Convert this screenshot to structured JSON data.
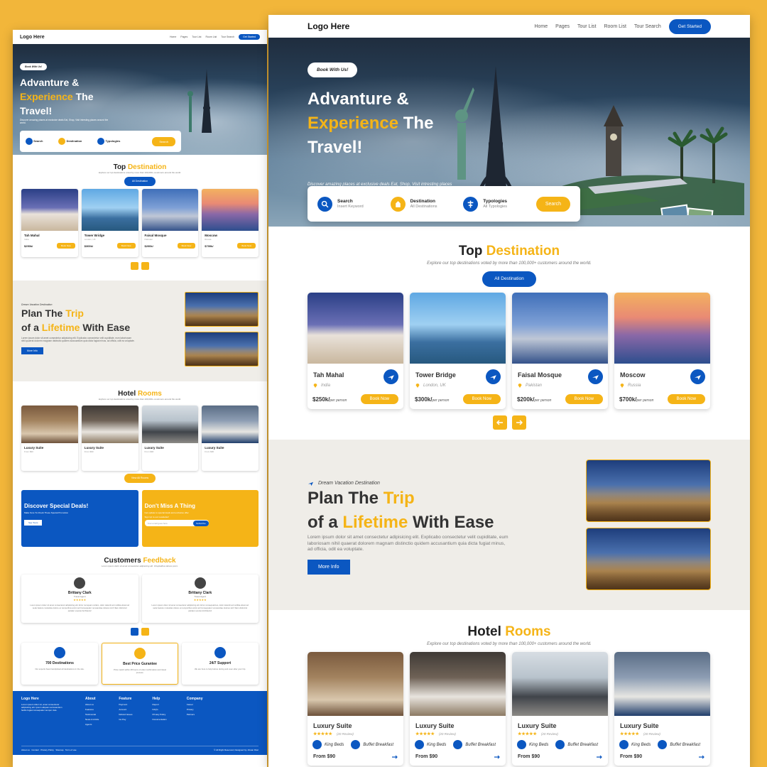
{
  "brand": {
    "logo": "Logo Here",
    "accent": "#F5B417",
    "primary": "#0B57C1",
    "frame_bg": "#F2B63A"
  },
  "nav": {
    "items": [
      "Home",
      "Pages",
      "Tour List",
      "Room List",
      "Tour Search"
    ],
    "cta": "Get Started"
  },
  "hero": {
    "badge": "Book With Us!",
    "title_a": "Advanture &",
    "title_b_accent": "Experience",
    "title_b_rest": " The",
    "title_c": "Travel!",
    "subtitle": "Discover amazing places at exclusive deals Eat, Shop, Visit intresting places around the world."
  },
  "search": {
    "fields": [
      {
        "label": "Search",
        "value": "Insert Keyword",
        "icon": "search-icon"
      },
      {
        "label": "Destination",
        "value": "All Destinations",
        "icon": "destination-icon"
      },
      {
        "label": "Typologies",
        "value": "All Typologies",
        "icon": "typology-icon"
      }
    ],
    "button": "Search"
  },
  "destinations": {
    "title_a": "Top ",
    "title_b": "Destination",
    "subtitle": "Explore our top destinations voted by more than 100,000+ customers around the world.",
    "button": "All Destination",
    "cards": [
      {
        "name": "Tah Mahal",
        "location": "India",
        "price": "$250k/",
        "unit": "per person",
        "cta": "Book Now"
      },
      {
        "name": "Tower Bridge",
        "location": "London, UK",
        "price": "$300k/",
        "unit": "per person",
        "cta": "Book Now"
      },
      {
        "name": "Faisal Mosque",
        "location": "Pakistan",
        "price": "$200k/",
        "unit": "per person",
        "cta": "Book Now"
      },
      {
        "name": "Moscow",
        "location": "Russia",
        "price": "$700k/",
        "unit": "per person",
        "cta": "Book Now"
      }
    ]
  },
  "plan": {
    "kicker": "Dream Vacation Destination",
    "title_a": "Plan The ",
    "title_b": "Trip",
    "title_c": "of a ",
    "title_d": "Lifetime",
    "title_e": " With Ease",
    "description": "Lorem ipsum dolor sit amet consectetur adipisicing elit. Explicabo consectetur velit cupiditate, eum laboriosam nihil quaerat dolorem magnam distinctio quidem accusantium quia dicta fugiat minus, ad officia, odit ea voluptate.",
    "button": "More Info"
  },
  "hotel": {
    "title_a": "Hotel ",
    "title_b": "Rooms",
    "subtitle": "Explore our top destinations voted by more than 100,000+ customers around the world.",
    "rooms": [
      {
        "name": "Luxury Suite",
        "stars": "★★★★★",
        "reviews": "(20 Review)",
        "bed": "King Beds",
        "food": "Buffet Breakfast",
        "price": "From $90"
      },
      {
        "name": "Luxury Suite",
        "stars": "★★★★★",
        "reviews": "(20 Review)",
        "bed": "King Beds",
        "food": "Buffet Breakfast",
        "price": "From $90"
      },
      {
        "name": "Luxury Suite",
        "stars": "★★★★★",
        "reviews": "(20 Review)",
        "bed": "King Beds",
        "food": "Buffet Breakfast",
        "price": "From $90"
      },
      {
        "name": "Luxury Suite",
        "stars": "★★★★★",
        "reviews": "(20 Review)",
        "bed": "King Beds",
        "food": "Buffet Breakfast",
        "price": "From $90"
      }
    ],
    "button": "View All Rooms"
  },
  "promos": {
    "deals_title": "Discover Special Deals!",
    "deals_sub": "Make Sure To Check These Special Promotion",
    "deals_btn": "See Tours",
    "miss_title": "Don't Miss A Thing",
    "miss_sub": "Get update to special deals and exclusive offer.",
    "miss_note": "Sign Up to our newsletter!",
    "email_placeholder": "Your email goes here",
    "subscribe": "Subscribe"
  },
  "feedback": {
    "title_a": "Customers ",
    "title_b": "Feedback",
    "subtitle": "Lorem ipsum dolor sit amet consectetur adipisicing elit. Voluptatibus labore porro.",
    "items": [
      {
        "name": "Brittany Clark",
        "role": "Travel Agent",
        "stars": "★★★★★",
        "text": "Lorem ipsum dolor sit amet consectetur adipisicing elit. Error numquam cullam, dolor deleniti ad mollitia eliusmod sede feature molestias dolore ex temporibus animi ad Consequatur recusandae dolores sint! Iliam distinctol pariatur eveniet Architecto!"
      },
      {
        "name": "Brittany Clark",
        "role": "Travel Agent",
        "stars": "★★★★★",
        "text": "Lorem ipsum dolor sit amet consectetur adipisicing elit. Error consequatinos, dolor deleniti ad mollitia eliusmod sede feature molestias dolore ex temporibus animi ad Consequatur recusandae dolores sint! Iliam distinctol pariatur eveniet Architecto!"
      }
    ]
  },
  "features": [
    {
      "title": "700 Destinations",
      "text": "Our experts have handpicked all destinations in the site."
    },
    {
      "title": "Best Price Gurantee",
      "text": "Price match within 48 hours of order confirmation and travel process."
    },
    {
      "title": "24/7 Support",
      "text": "We are here to help before during and even after your trip."
    }
  ],
  "footer": {
    "about_text": "Lorem ipsum dolor sit, amet consectetur adipisicing elit. Ipsum aliquam accusantium facilis fugiat consequatur tempor duis.",
    "cols": [
      {
        "title": "About",
        "items": [
          "About us",
          "Features",
          "Testimonial",
          "News & Article",
          "Agents"
        ]
      },
      {
        "title": "Feature",
        "items": [
          "Payment",
          "Account",
          "Refund Issues",
          "Go Pay"
        ]
      },
      {
        "title": "Help",
        "items": [
          "Report",
          "FAQ's",
          "Privacy Policy",
          "Documentation"
        ]
      },
      {
        "title": "Company",
        "items": [
          "Career",
          "Privacy",
          "Partners"
        ]
      }
    ],
    "bottom_links": [
      "About us",
      "Contact",
      "Privacy Policy",
      "Sitemap",
      "Term of use"
    ],
    "copyright": "© All Right Reserved, Designed by: Ahsan Riaz"
  }
}
